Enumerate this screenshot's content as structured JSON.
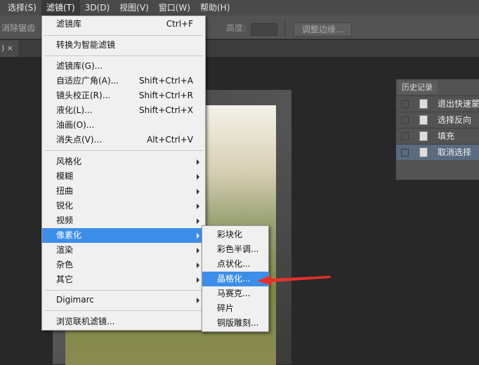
{
  "menubar": [
    "选择(S)",
    "滤镜(T)",
    "3D(D)",
    "视图(V)",
    "窗口(W)",
    "帮助(H)"
  ],
  "options": {
    "antialias": "消除锯齿",
    "height_label": "高度:",
    "refine_edge": "调整边缘..."
  },
  "tab": {
    "close": "×"
  },
  "filter_menu": [
    {
      "label": "滤镜库",
      "shortcut": "Ctrl+F"
    },
    {
      "label": "转换为智能滤镜"
    },
    {
      "label": "滤镜库(G)..."
    },
    {
      "label": "自适应广角(A)...",
      "shortcut": "Shift+Ctrl+A"
    },
    {
      "label": "镜头校正(R)...",
      "shortcut": "Shift+Ctrl+R"
    },
    {
      "label": "液化(L)...",
      "shortcut": "Shift+Ctrl+X"
    },
    {
      "label": "油画(O)..."
    },
    {
      "label": "消失点(V)...",
      "shortcut": "Alt+Ctrl+V"
    },
    {
      "label": "风格化"
    },
    {
      "label": "模糊"
    },
    {
      "label": "扭曲"
    },
    {
      "label": "锐化"
    },
    {
      "label": "视频"
    },
    {
      "label": "像素化"
    },
    {
      "label": "渲染"
    },
    {
      "label": "杂色"
    },
    {
      "label": "其它"
    },
    {
      "label": "Digimarc"
    },
    {
      "label": "浏览联机滤镜..."
    }
  ],
  "pixelate_submenu": [
    "彩块化",
    "彩色半调...",
    "点状化...",
    "晶格化...",
    "马赛克...",
    "碎片",
    "铜版雕刻..."
  ],
  "history": {
    "title": "历史记录",
    "items": [
      "退出快速蒙",
      "选择反向",
      "填充",
      "取消选择"
    ]
  },
  "colors": {
    "highlight": "#3d8ee8",
    "arrow": "#e8302a"
  }
}
